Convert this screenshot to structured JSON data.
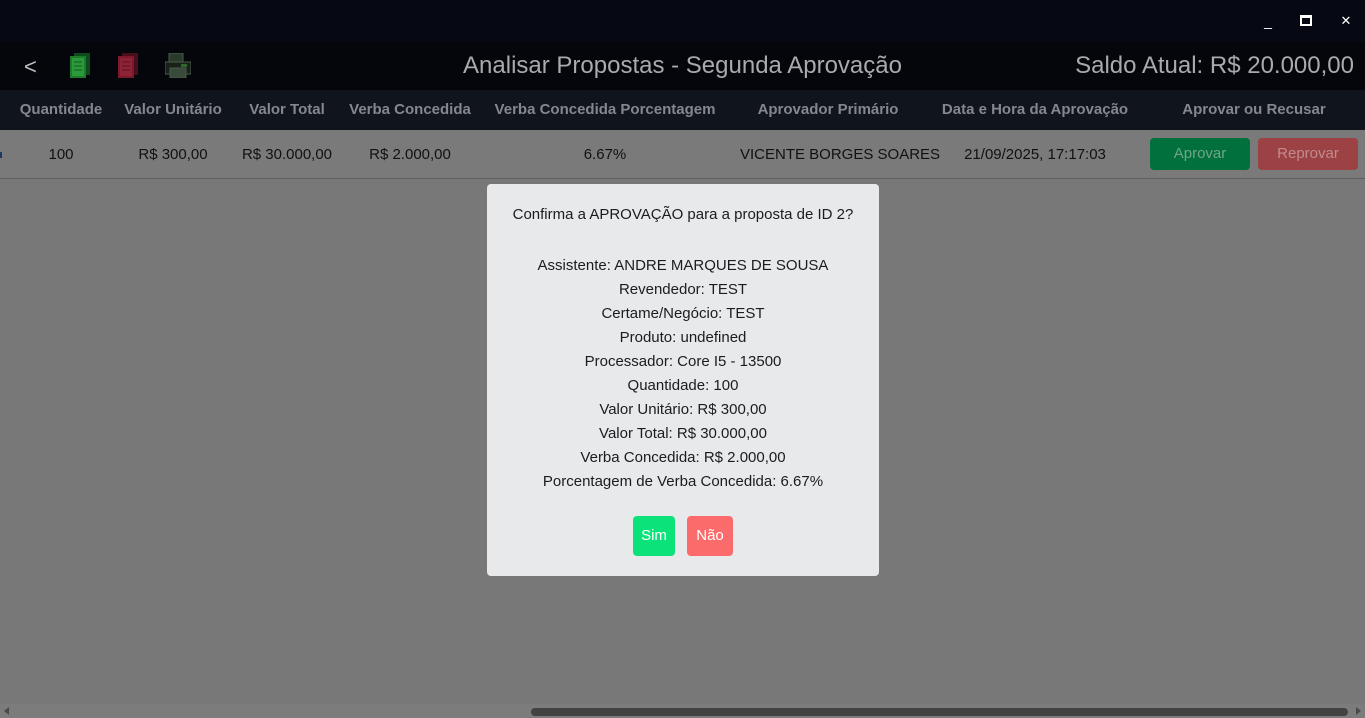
{
  "window": {
    "minimize_label": "_",
    "close_label": "✕"
  },
  "header": {
    "back_label": "<",
    "title": "Analisar Propostas - Segunda Aprovação",
    "saldo": "Saldo Atual: R$ 20.000,00",
    "icons": [
      "excel-export-icon",
      "pdf-export-icon",
      "print-icon"
    ]
  },
  "table": {
    "columns": [
      "Quantidade",
      "Valor Unitário",
      "Valor Total",
      "Verba Concedida",
      "Verba Concedida Porcentagem",
      "Aprovador Primário",
      "Data e Hora da Aprovação",
      "Aprovar ou Recusar"
    ],
    "rows": [
      {
        "quantidade": "100",
        "valor_unitario": "R$ 300,00",
        "valor_total": "R$ 30.000,00",
        "verba_concedida": "R$ 2.000,00",
        "verba_porcentagem": "6.67%",
        "aprovador": "VICENTE BORGES SOARES",
        "data_hora": "21/09/2025, 17:17:03",
        "approve_label": "Aprovar",
        "reject_label": "Reprovar"
      }
    ]
  },
  "modal": {
    "question": "Confirma a APROVAÇÃO para a proposta de ID 2?",
    "lines": [
      "Assistente: ANDRE MARQUES DE SOUSA",
      "Revendedor: TEST",
      "Certame/Negócio: TEST",
      "Produto: undefined",
      "Processador: Core I5 - 13500",
      "Quantidade: 100",
      "Valor Unitário: R$ 300,00",
      "Valor Total: R$ 30.000,00",
      "Verba Concedida: R$ 2.000,00",
      "Porcentagem de Verba Concedida: 6.67%"
    ],
    "yes_label": "Sim",
    "no_label": "Não"
  },
  "colors": {
    "titlebar": "#060813",
    "overlay": "#787878",
    "modal_bg": "#e8e9eb",
    "yes": "#0be27a",
    "no": "#fc6b6c",
    "approve": "#01703c",
    "reject": "#9c4245"
  }
}
